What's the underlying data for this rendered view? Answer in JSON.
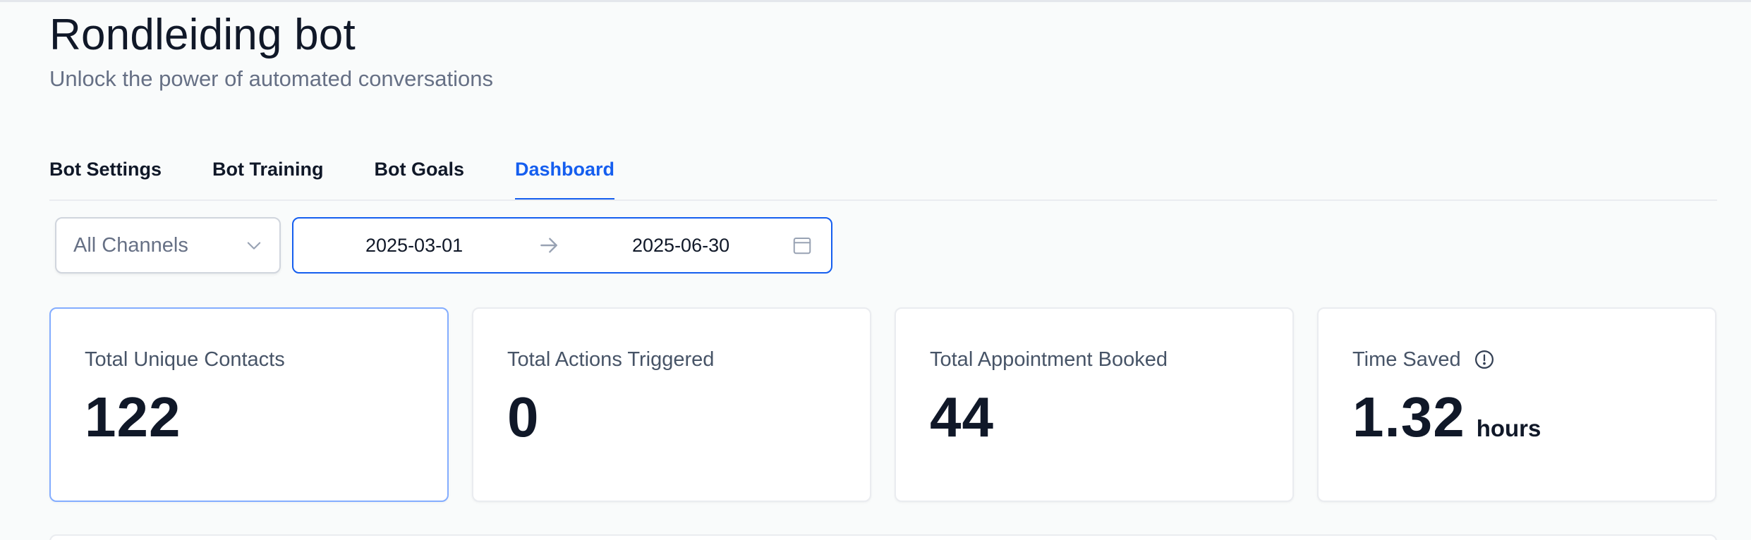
{
  "header": {
    "title": "Rondleiding bot",
    "subtitle": "Unlock the power of automated conversations"
  },
  "tabs": [
    {
      "label": "Bot Settings",
      "active": false
    },
    {
      "label": "Bot Training",
      "active": false
    },
    {
      "label": "Bot Goals",
      "active": false
    },
    {
      "label": "Dashboard",
      "active": true
    }
  ],
  "filters": {
    "channel": {
      "value": "All Channels",
      "icon": "chevron-down-icon"
    },
    "date_range": {
      "start": "2025-03-01",
      "end": "2025-06-30",
      "separator_icon": "arrow-right-icon",
      "icon": "calendar-icon"
    }
  },
  "stats": [
    {
      "label": "Total Unique Contacts",
      "value": "122",
      "unit": "",
      "selected": true
    },
    {
      "label": "Total Actions Triggered",
      "value": "0",
      "unit": "",
      "selected": false
    },
    {
      "label": "Total Appointment Booked",
      "value": "44",
      "unit": "",
      "selected": false
    },
    {
      "label": "Time Saved",
      "value": "1.32",
      "unit": "hours",
      "selected": false,
      "icon": "info-icon"
    }
  ],
  "colors": {
    "accent": "#155eef",
    "text": "#101828",
    "muted": "#667085",
    "border": "#eaecf0"
  }
}
